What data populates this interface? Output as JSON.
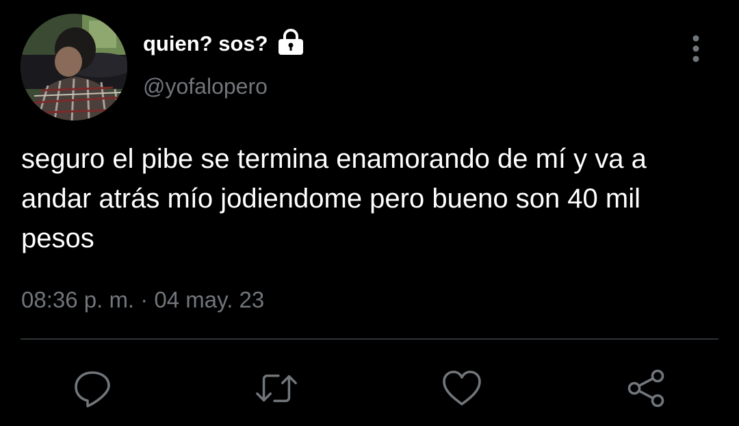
{
  "tweet": {
    "author": {
      "display_name": "quien? sos?",
      "handle": "@yofalopero",
      "protected_icon": "lock-icon",
      "avatar": "profile-photo"
    },
    "menu_icon": "more-vertical-icon",
    "text": "seguro el pibe se termina enamorando de mí y va a andar atrás mío jodiendome pero bueno son 40 mil pesos",
    "timestamp": "08:36 p. m. · 04 may. 23"
  },
  "actions": [
    {
      "name": "reply",
      "icon": "reply-icon"
    },
    {
      "name": "retweet",
      "icon": "retweet-icon"
    },
    {
      "name": "like",
      "icon": "heart-icon"
    },
    {
      "name": "share",
      "icon": "share-icon"
    }
  ],
  "colors": {
    "background": "#000000",
    "primary_text": "#ffffff",
    "secondary_text": "#71767b",
    "divider": "#2f3336",
    "icon": "#71767b"
  }
}
